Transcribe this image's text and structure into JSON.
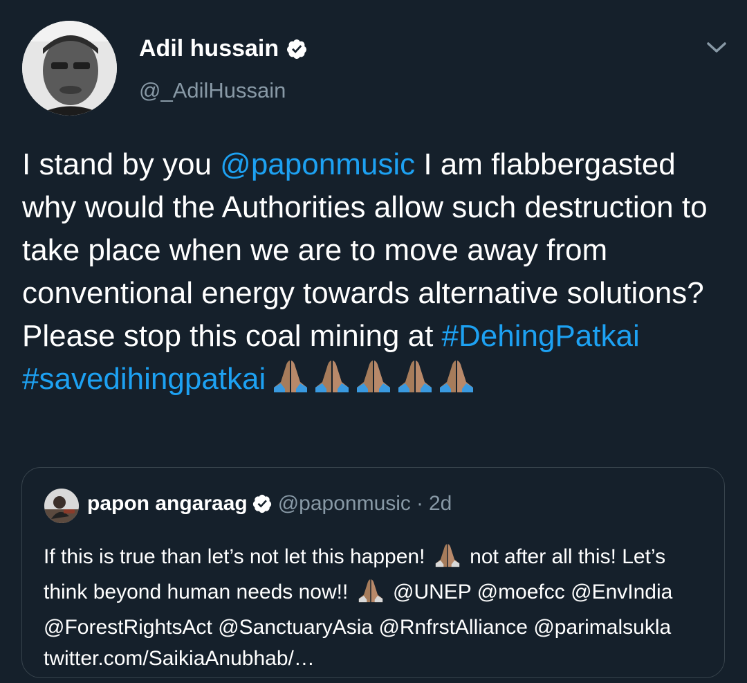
{
  "tweet": {
    "author": {
      "display_name": "Adil hussain",
      "handle": "@_AdilHussain",
      "verified": true
    },
    "text_parts": {
      "t1": "I stand by you ",
      "mention1": "@paponmusic",
      "t2": " I am flabbergasted why would the Authorities allow such destruction to take place when we are to move away from conventional energy towards alternative solutions? Please stop this coal mining at ",
      "hashtag1": "#DehingPatkai",
      "t3": " ",
      "hashtag2": "#savedihingpatkai"
    },
    "emoji": [
      "folded-hands",
      "folded-hands",
      "folded-hands",
      "folded-hands",
      "folded-hands"
    ]
  },
  "quoted_tweet": {
    "author": {
      "display_name": "papon angaraag",
      "handle": "@paponmusic",
      "verified": true
    },
    "separator": "·",
    "time": "2d",
    "text_parts": {
      "t1": "If this is true than let’s not let this happen!",
      "t2": "not after all this! Let’s think beyond human needs now!!",
      "m1": "@UNEP",
      "m2": "@moefcc",
      "m3": "@EnvIndia",
      "m4": "@ForestRightsAct",
      "m5": "@SanctuaryAsia",
      "m6": "@RnfrstAlliance",
      "m7": "@parimalsukla",
      "link": "twitter.com/SaikiaAnubhab/…"
    }
  },
  "colors": {
    "background": "#15202b",
    "link": "#1da1f2",
    "secondary_text": "#8899a6",
    "border": "#38444d"
  },
  "icons": [
    "verified-badge-icon",
    "chevron-down-icon",
    "folded-hands-emoji"
  ]
}
